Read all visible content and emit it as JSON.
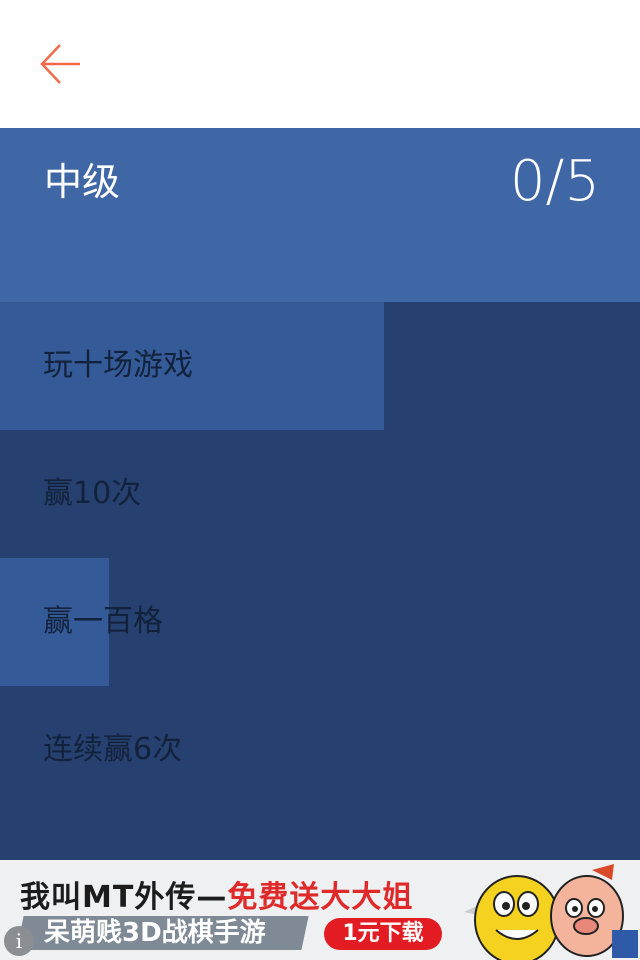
{
  "header": {
    "back_icon": "arrow-left-icon",
    "accent_color": "#f26a4b"
  },
  "level": {
    "title": "中级",
    "progress": "0/5",
    "background": "#3f66a5"
  },
  "tasks": [
    {
      "label": "玩十场游戏",
      "completion": 0.6
    },
    {
      "label": "赢10次",
      "completion": 0
    },
    {
      "label": "赢一百格",
      "completion": 0.17
    },
    {
      "label": "连续赢6次",
      "completion": 0
    }
  ],
  "ad": {
    "line1_a": "我叫MT外传—",
    "line1_b": "免费送大大姐",
    "line2": "呆萌贱3D战棋手游",
    "cta": "1元下载",
    "info_icon": "info-icon",
    "highlight_color": "#e02a2a"
  }
}
